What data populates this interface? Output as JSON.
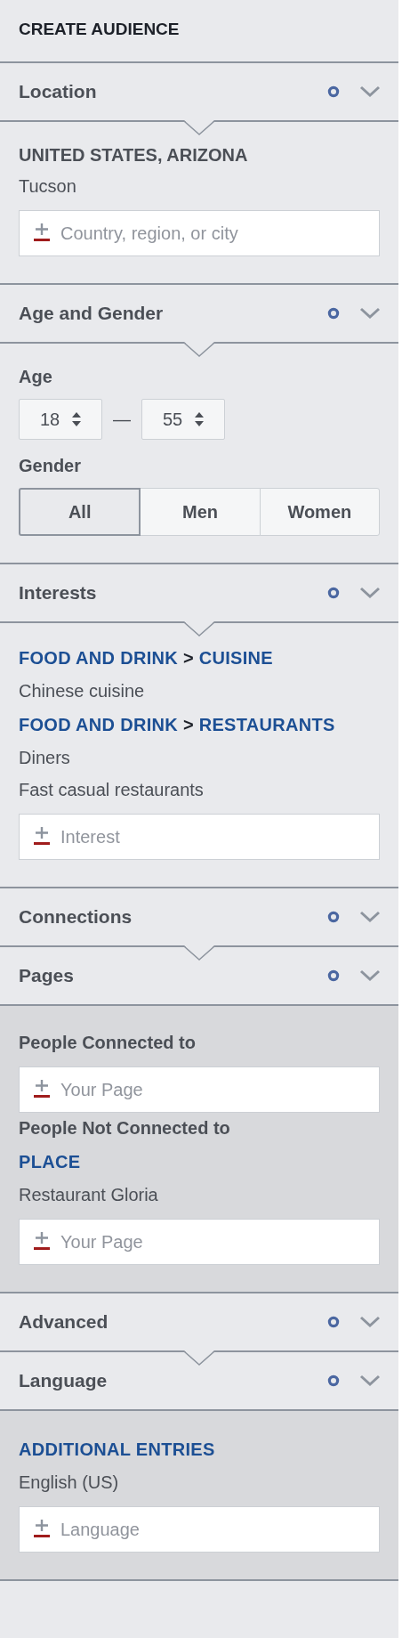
{
  "title": "CREATE AUDIENCE",
  "sections": [
    {
      "title": "Location",
      "pointer": true,
      "content": [
        {
          "kind": "heading",
          "text": "UNITED STATES, ARIZONA"
        },
        {
          "kind": "value",
          "text": "Tucson"
        },
        {
          "kind": "input",
          "placeholder": "Country, region, or city"
        }
      ]
    },
    {
      "title": "Age and Gender",
      "pointer": true,
      "content": [
        {
          "kind": "label",
          "text": "Age"
        },
        {
          "kind": "age_range",
          "from": "18",
          "separator": "—",
          "to": "55"
        },
        {
          "kind": "label",
          "text": "Gender"
        },
        {
          "kind": "segmented",
          "options": [
            {
              "label": "All",
              "selected": true
            },
            {
              "label": "Men",
              "selected": false
            },
            {
              "label": "Women",
              "selected": false
            }
          ]
        }
      ]
    },
    {
      "title": "Interests",
      "pointer": true,
      "content": [
        {
          "kind": "category",
          "parts": [
            {
              "text": "FOOD AND DRINK",
              "link": true
            },
            {
              "text": ">",
              "link": false
            },
            {
              "text": "CUISINE",
              "link": true
            }
          ]
        },
        {
          "kind": "value",
          "text": "Chinese cuisine"
        },
        {
          "kind": "category",
          "parts": [
            {
              "text": "FOOD AND DRINK",
              "link": true
            },
            {
              "text": ">",
              "link": false
            },
            {
              "text": "RESTAURANTS",
              "link": true
            }
          ]
        },
        {
          "kind": "value",
          "text": "Diners"
        },
        {
          "kind": "value",
          "text": "Fast casual restaurants"
        },
        {
          "kind": "input",
          "placeholder": "Interest"
        }
      ]
    },
    {
      "title": "Connections",
      "pointer": true
    },
    {
      "title": "Pages",
      "shaded": true,
      "content": [
        {
          "kind": "label",
          "text": "People Connected to"
        },
        {
          "kind": "input",
          "placeholder": "Your Page"
        },
        {
          "kind": "label",
          "text": "People Not Connected to"
        },
        {
          "kind": "category",
          "parts": [
            {
              "text": "PLACE",
              "link": true
            }
          ]
        },
        {
          "kind": "value",
          "text": "Restaurant Gloria"
        },
        {
          "kind": "input",
          "placeholder": "Your Page"
        }
      ]
    },
    {
      "title": "Advanced",
      "pointer": true
    },
    {
      "title": "Language",
      "shaded": true,
      "content": [
        {
          "kind": "category",
          "parts": [
            {
              "text": "ADDITIONAL ENTRIES",
              "link": true
            }
          ]
        },
        {
          "kind": "value",
          "text": "English (US)"
        },
        {
          "kind": "input",
          "placeholder": "Language"
        }
      ]
    }
  ]
}
